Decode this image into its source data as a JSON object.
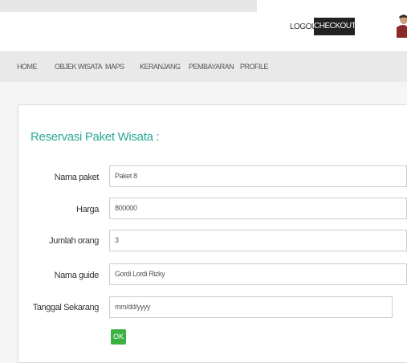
{
  "header": {
    "logout_label": "LOGOUT",
    "checkout_label": "CHECKOUT"
  },
  "nav": {
    "items": [
      "HOME",
      "OBJEK WISATA",
      "MAPS",
      "KERANJANG",
      "PEMBAYARAN",
      "PROFILE"
    ]
  },
  "form": {
    "title": "Reservasi Paket Wisata :",
    "fields": [
      {
        "label": "Nama paket",
        "value": "Paket 8"
      },
      {
        "label": "Harga",
        "value": "800000"
      },
      {
        "label": "Jumlah orang",
        "value": "3"
      },
      {
        "label": "Nama guide",
        "value": "Gordi Lordi Rizky"
      },
      {
        "label": "Tanggal Sekarang",
        "value": "mm/dd/yyyy"
      }
    ],
    "submit_label": "OK"
  },
  "colors": {
    "accent": "#28a894",
    "button_dark": "#222222",
    "button_green": "#3cb043"
  },
  "icons": {
    "avatar": "user-avatar"
  }
}
